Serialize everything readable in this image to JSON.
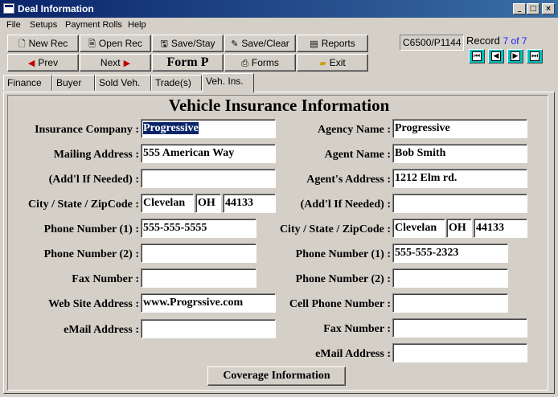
{
  "window": {
    "title": "Deal Information",
    "min": "_",
    "max": "□",
    "close": "×"
  },
  "menu": [
    "File",
    "Setups",
    "Payment Rolls",
    "Help"
  ],
  "toolbar": {
    "new_rec": "New Rec",
    "open_rec": "Open Rec",
    "save_stay": "Save/Stay",
    "save_clear": "Save/Clear",
    "reports": "Reports",
    "prev": "Prev",
    "next": "Next",
    "form": "Form P",
    "forms": "Forms",
    "exit": "Exit"
  },
  "deal_code": "C6500/P1144",
  "record": {
    "label": "Record",
    "position": "7 of 7"
  },
  "tabs": [
    "Finance",
    "Buyer",
    "Sold Veh.",
    "Trade(s)",
    "Veh. Ins."
  ],
  "active_tab": "Veh. Ins.",
  "form_title": "Vehicle Insurance Information",
  "insurance": {
    "company_label": "Insurance Company :",
    "company": "Progressive",
    "mailing_label": "Mailing Address :",
    "mailing": "555 American Way",
    "addl_label": "(Add'l If Needed) :",
    "addl": "",
    "csz_label": "City / State / ZipCode :",
    "city": "Clevelan",
    "state": "OH",
    "zip": "44133",
    "phone1_label": "Phone Number (1) :",
    "phone1": "555-555-5555",
    "phone2_label": "Phone Number (2) :",
    "phone2": "",
    "fax_label": "Fax Number :",
    "fax": "",
    "web_label": "Web Site Address :",
    "web": "www.Progrssive.com",
    "email_label": "eMail Address :",
    "email": ""
  },
  "agency": {
    "name_label": "Agency Name :",
    "name": "Progressive",
    "agent_label": "Agent Name :",
    "agent": "Bob Smith",
    "address_label": "Agent's Address :",
    "address": "1212 Elm rd.",
    "addl_label": "(Add'l If Needed) :",
    "addl": "",
    "csz_label": "City / State / ZipCode :",
    "city": "Clevelan",
    "state": "OH",
    "zip": "44133",
    "phone1_label": "Phone Number (1) :",
    "phone1": "555-555-2323",
    "phone2_label": "Phone Number (2) :",
    "phone2": "",
    "cell_label": "Cell Phone Number :",
    "cell": "",
    "fax_label": "Fax Number :",
    "fax": "",
    "email_label": "eMail Address :",
    "email": ""
  },
  "coverage_button": "Coverage Information",
  "icons": {
    "prev": "◀",
    "next": "▶",
    "first": "⏮",
    "back": "◀",
    "fwd": "▶",
    "last": "⏭"
  }
}
